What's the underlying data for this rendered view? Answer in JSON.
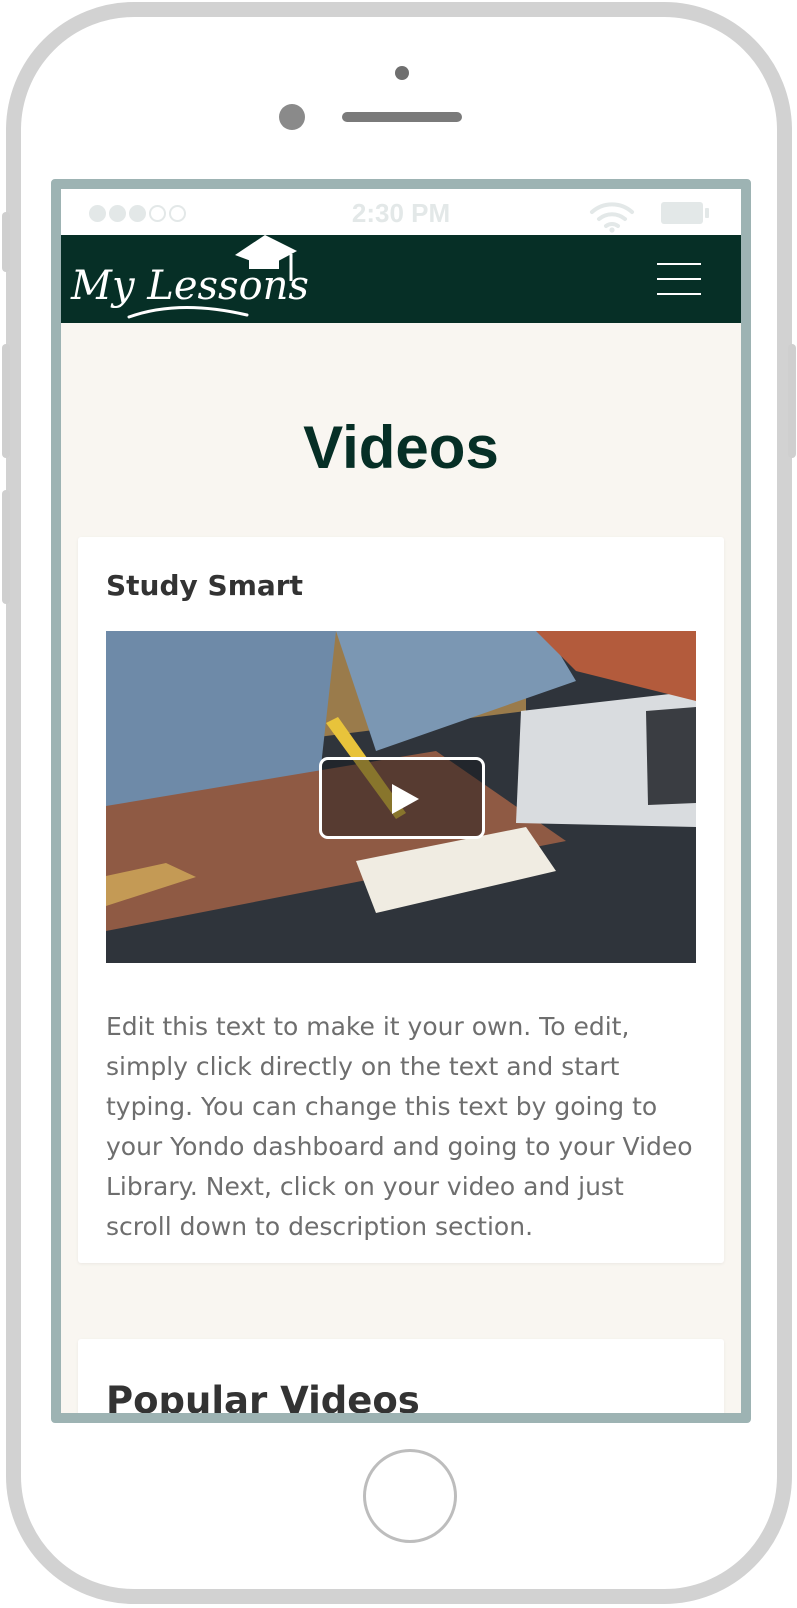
{
  "status_bar": {
    "time": "2:30 PM",
    "signal_icon": "signal-dots-icon",
    "wifi_icon": "wifi-icon",
    "battery_icon": "battery-icon"
  },
  "nav": {
    "logo_text": "My Lessons",
    "logo_icon": "graduation-cap-icon",
    "menu_icon": "hamburger-icon",
    "background_color": "#062f26"
  },
  "page": {
    "title": "Videos",
    "title_color": "#062f26",
    "background_color": "#f9f6f1"
  },
  "video_card": {
    "title": "Study Smart",
    "play_icon": "play-icon",
    "description": "Edit this text to make it your own. To edit, simply click directly on the text and start typing. You can change this text by going to your Yondo dashboard and going to your Video Library. Next, click on your video and just scroll down to description section."
  },
  "popular_section": {
    "title": "Popular Videos"
  }
}
